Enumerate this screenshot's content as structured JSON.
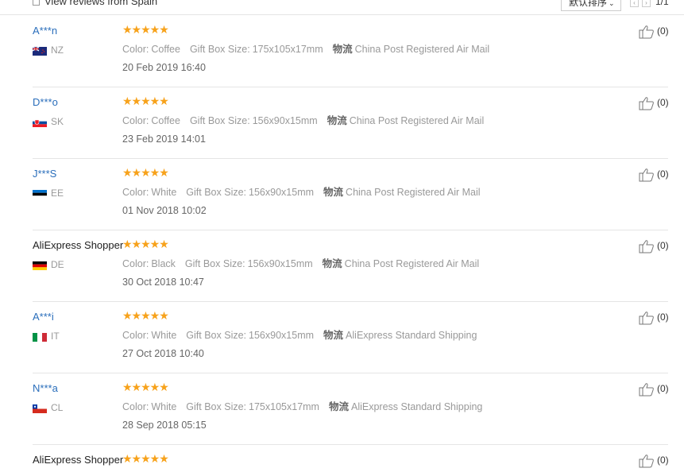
{
  "filter": {
    "checkbox_label": "View reviews from Spain"
  },
  "sort": {
    "label": "默认排序"
  },
  "pagination": {
    "prev": "‹",
    "next": "›",
    "info": "1/1"
  },
  "labels": {
    "color": "Color:",
    "size": "Gift Box Size:",
    "shipping": "物流"
  },
  "reviews": [
    {
      "name": "A***n",
      "country": "NZ",
      "flag": "nz-flag-icon",
      "stars": "★★★★★",
      "color": "Coffee",
      "size": "175x105x17mm",
      "shipping": "China Post Registered Air Mail",
      "date": "20 Feb 2019 16:40",
      "likes": "(0)"
    },
    {
      "name": "D***o",
      "country": "SK",
      "flag": "sk-flag-icon",
      "stars": "★★★★★",
      "color": "Coffee",
      "size": "156x90x15mm",
      "shipping": "China Post Registered Air Mail",
      "date": "23 Feb 2019 14:01",
      "likes": "(0)"
    },
    {
      "name": "J***S",
      "country": "EE",
      "flag": "ee-flag-icon",
      "stars": "★★★★★",
      "color": "White",
      "size": "156x90x15mm",
      "shipping": "China Post Registered Air Mail",
      "date": "01 Nov 2018 10:02",
      "likes": "(0)"
    },
    {
      "name": "AliExpress Shopper",
      "country": "DE",
      "flag": "de-flag-icon",
      "stars": "★★★★★",
      "color": "Black",
      "size": "156x90x15mm",
      "shipping": "China Post Registered Air Mail",
      "date": "30 Oct 2018 10:47",
      "likes": "(0)"
    },
    {
      "name": "A***i",
      "country": "IT",
      "flag": "it-flag-icon",
      "stars": "★★★★★",
      "color": "White",
      "size": "156x90x15mm",
      "shipping": "AliExpress Standard Shipping",
      "date": "27 Oct 2018 10:40",
      "likes": "(0)"
    },
    {
      "name": "N***a",
      "country": "CL",
      "flag": "cl-flag-icon",
      "stars": "★★★★★",
      "color": "White",
      "size": "175x105x17mm",
      "shipping": "AliExpress Standard Shipping",
      "date": "28 Sep 2018 05:15",
      "likes": "(0)"
    },
    {
      "name": "AliExpress Shopper",
      "stars": "★★★★★",
      "likes": "(0)"
    }
  ],
  "colors": {
    "link": "#2a6ebb",
    "star": "#f7a21b",
    "muted": "#999999"
  }
}
